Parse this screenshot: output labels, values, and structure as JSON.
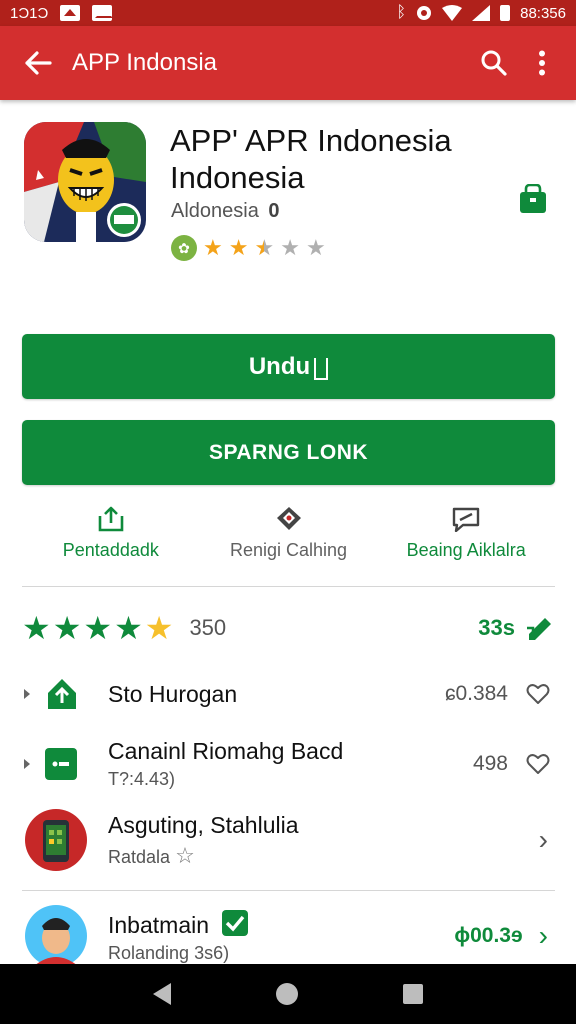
{
  "status_bar": {
    "carrier_text": "1Ɔ1Ɔ",
    "time": "88:356",
    "icons": [
      "image-notification-icon",
      "mail-notification-icon",
      "bluetooth-icon",
      "alarm-icon",
      "wifi-icon",
      "signal-icon",
      "battery-icon"
    ]
  },
  "app_bar": {
    "title": "APP Indonsia",
    "color": "#d32f2f",
    "back_icon": "arrow-back-icon",
    "search_icon": "search-icon",
    "more_icon": "more-vert-icon"
  },
  "app": {
    "title": "APP' APR Indonesia Indonesia",
    "developer": "Aldonesia",
    "developer_badge": "0",
    "rating_stars": 2.5,
    "rating_max": 5,
    "bag_icon": "shopping-bag-icon"
  },
  "buttons": {
    "install_label": "Undu",
    "share_label": "SPARNG LONK",
    "color": "#0f8a3b"
  },
  "actions": [
    {
      "label": "Pentaddadk",
      "icon": "share-icon"
    },
    {
      "label": "Renigi Calhing",
      "icon": "diamond-pin-icon"
    },
    {
      "label": "Beaing Aiklalra",
      "icon": "chat-bubble-icon"
    }
  ],
  "summary": {
    "stars_filled": 4,
    "stars_total": 5,
    "count": "350",
    "right_value": "33s",
    "right_icon": "edit-icon"
  },
  "list": [
    {
      "title": "Sto Hurogan",
      "subtitle": "",
      "price": "ɕ0.384",
      "icon": "upload-icon",
      "trailing": "heart-icon"
    },
    {
      "title": "Canainl Riomahg Bacd",
      "subtitle": "T?:4.43)",
      "price": "498",
      "icon": "card-icon",
      "trailing": "heart-icon"
    },
    {
      "title": "Asguting, Stahlulia",
      "subtitle": "Ratdala",
      "price": "",
      "icon": "phone-app-icon",
      "trailing": "chevron-right-icon"
    },
    {
      "title": "Inbatmain",
      "subtitle": "Rolanding 3s6)",
      "price": "ɸ00.3ɘ",
      "icon": "avatar-icon",
      "trailing": "chevron-right-icon"
    }
  ]
}
